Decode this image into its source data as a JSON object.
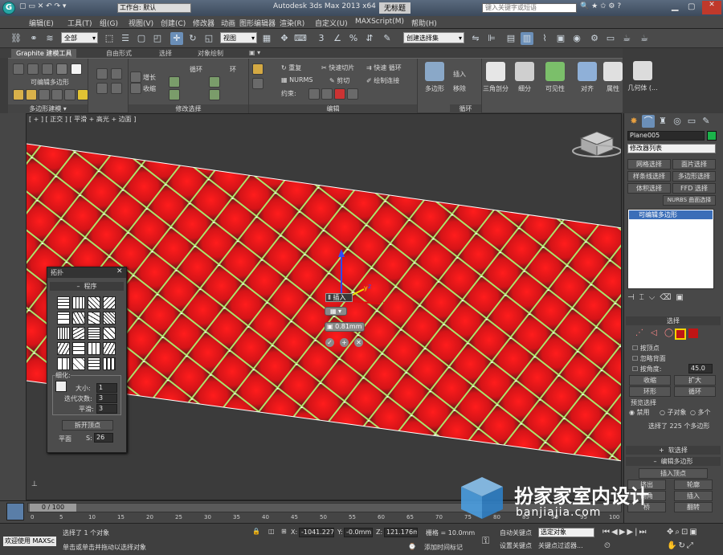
{
  "title": {
    "workspace": "工作台: 默认",
    "app": "Autodesk 3ds Max  2013 x64",
    "doc": "无标题",
    "search_placeholder": "键入关键字或短语"
  },
  "menu": [
    "编辑(E)",
    "工具(T)",
    "组(G)",
    "视图(V)",
    "创建(C)",
    "修改器",
    "动画",
    "图形编辑器",
    "渲染(R)",
    "自定义(U)",
    "MAXScript(M)",
    "帮助(H)"
  ],
  "toolbar": {
    "filter": "全部",
    "refcoord": "视图",
    "selset": "创建选择集"
  },
  "ribbon": {
    "tabs": [
      "Graphite 建模工具",
      "自由形式",
      "选择",
      "对象绘制"
    ],
    "groups": {
      "polymodel": "多边形建模",
      "editable": "可编辑多边形",
      "modsel": "修改选择",
      "edit": "编辑",
      "loop": "循环"
    },
    "modsel_items": {
      "grow": "增长",
      "shrink": "收缩",
      "loop": "循环",
      "ring": "环"
    },
    "edit_items": {
      "repeat": "重复",
      "quickslice": "快速切片",
      "quickloop": "快速 循环",
      "nurms": "NURMS",
      "cut": "剪切",
      "paintconnect": "绘制连接",
      "constrain": "约束:"
    },
    "poly_label": "多边形",
    "insert": "插入",
    "remove": "移除",
    "big_buttons": [
      "三角剖分",
      "细分",
      "可见性",
      "对齐",
      "属性",
      "几何体 (..."
    ]
  },
  "viewport": {
    "label": "[ + ] [ 正交 ] [ 平滑 + 高光 + 边面 ]",
    "caddy_insert": "插入",
    "caddy_value": "0.81mm",
    "axis_x": "x",
    "axis_y": "y",
    "axis_z": "z"
  },
  "floatpanel": {
    "title": "拓扑",
    "section": "程序",
    "refine": "细化:",
    "size_label": "大小:",
    "size_val": "1",
    "iter_label": "迭代次数:",
    "iter_val": "3",
    "smooth_label": "平滑:",
    "smooth_val": "3",
    "remove_btn": "拆开顶点",
    "plane_label": "平面",
    "s_label": "S:",
    "s_val": "26"
  },
  "cmdpanel": {
    "objname": "Plane005",
    "modlist": "修改器列表",
    "buttons": [
      "网格选择",
      "面片选择",
      "样条线选择",
      "多边形选择",
      "体积选择",
      "FFD 选择",
      "NURBS 曲面选择"
    ],
    "stack_item": "可编辑多边形",
    "sel_head": "选择",
    "bydegree": "按顶点",
    "ignoreback": "忽略背面",
    "byangle": "按角度:",
    "angle_val": "45.0",
    "shrink": "收缩",
    "grow": "扩大",
    "ring": "环形",
    "loop": "循环",
    "preview": "预览选择",
    "off": "禁用",
    "subobj": "子对象",
    "multi": "多个",
    "selected": "选择了 225 个多边形",
    "softsel": "软选择",
    "editpoly": "编辑多边形",
    "insertvert": "插入顶点",
    "extrude": "挤出",
    "outline": "轮廓",
    "bevel": "倒角",
    "inset": "插入",
    "bridge": "桥",
    "flip": "翻转"
  },
  "timeline": {
    "frame": "0 / 100",
    "ticks": [
      "0",
      "5",
      "10",
      "15",
      "20",
      "25",
      "30",
      "35",
      "40",
      "45",
      "50",
      "55",
      "60",
      "65",
      "70",
      "75",
      "80",
      "85",
      "90",
      "95",
      "100"
    ]
  },
  "status": {
    "welcome": "欢迎使用 MAXSc",
    "selected": "选择了 1 个对象",
    "hint": "单击或单击并拖动以选择对象",
    "x_label": "X:",
    "x_val": "-1041.227",
    "y_label": "Y:",
    "y_val": "-0.0mm",
    "z_label": "Z:",
    "z_val": "121.176mm",
    "grid": "栅格 = 10.0mm",
    "autokey": "自动关键点",
    "selobj": "选定对象",
    "setkey": "设置关键点",
    "keyfilter": "关键点过滤器...",
    "addtime": "添加时间标记"
  },
  "watermark": {
    "cn": "扮家家室内设计",
    "url": "banjiajia.com"
  },
  "colors": {
    "panel": "#484848",
    "accent": "#f5d300",
    "mesh_red": "#e0171b",
    "edge_green": "#aee36b"
  }
}
